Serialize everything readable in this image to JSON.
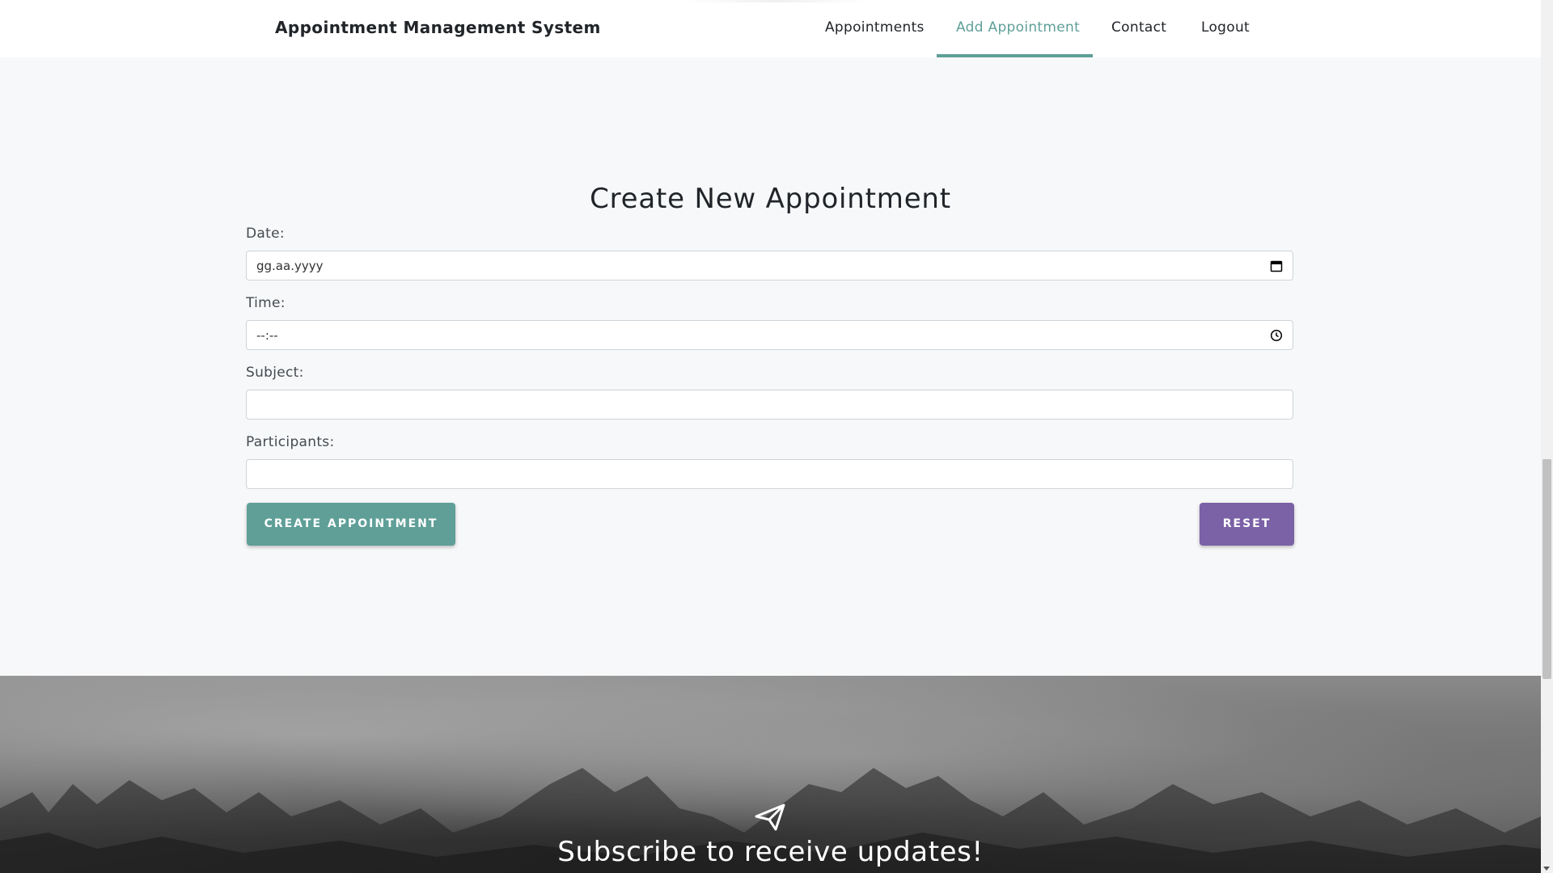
{
  "header": {
    "brand": "Appointment Management System",
    "nav": [
      "Appointments",
      "Add Appointment",
      "Contact",
      "Logout"
    ],
    "active_nav": "Add Appointment"
  },
  "form": {
    "title": "Create New Appointment",
    "date_label": "Date:",
    "date_value": "gg.aa.yyyy",
    "time_label": "Time:",
    "time_value": "--:--",
    "subject_label": "Subject:",
    "subject_value": "",
    "participants_label": "Participants:",
    "participants_value": "",
    "create_button": "CREATE APPOINTMENT",
    "reset_button": "RESET"
  },
  "footer": {
    "subscribe_text": "Subscribe to receive updates!",
    "icon": "paper-plane-icon"
  },
  "colors": {
    "accent": "#5f9f98",
    "reset": "#7b61a6",
    "background": "#f7f8f9"
  }
}
